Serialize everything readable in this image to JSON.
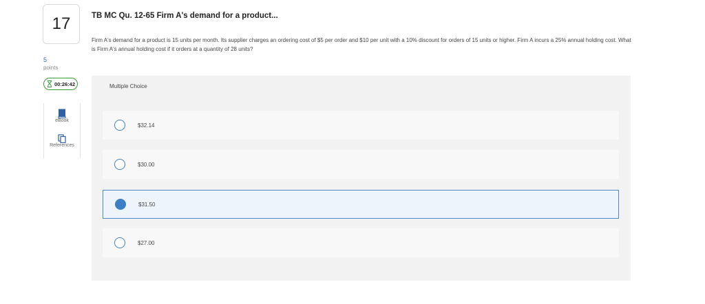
{
  "question": {
    "number": "17",
    "points_value": "5",
    "points_label": "points",
    "timer": "00:26:42",
    "title": "TB MC Qu. 12-65 Firm A's demand for a product...",
    "text": "Firm A's demand for a product is 15 units per month. Its supplier charges an ordering cost of $5 per order and $10 per unit with a 10% discount for orders of 15 units or higher. Firm A incurs a 25% annual holding cost. What is Firm A's annual holding cost if it orders at a quantity of 28 units?",
    "type_label": "Multiple Choice"
  },
  "tools": {
    "ebook_label": "eBook",
    "ebook_icon": "book-icon",
    "references_label": "References",
    "references_icon": "copy-icon"
  },
  "choices": [
    {
      "label": "$32.14",
      "selected": false
    },
    {
      "label": "$30.00",
      "selected": false
    },
    {
      "label": "$31.50",
      "selected": true
    },
    {
      "label": "$27.00",
      "selected": false
    }
  ],
  "colors": {
    "accent": "#3d7fc4",
    "timer_border": "#3a9a3a",
    "panel_bg": "#f2f2f2",
    "selected_bg": "#eef4fb"
  }
}
